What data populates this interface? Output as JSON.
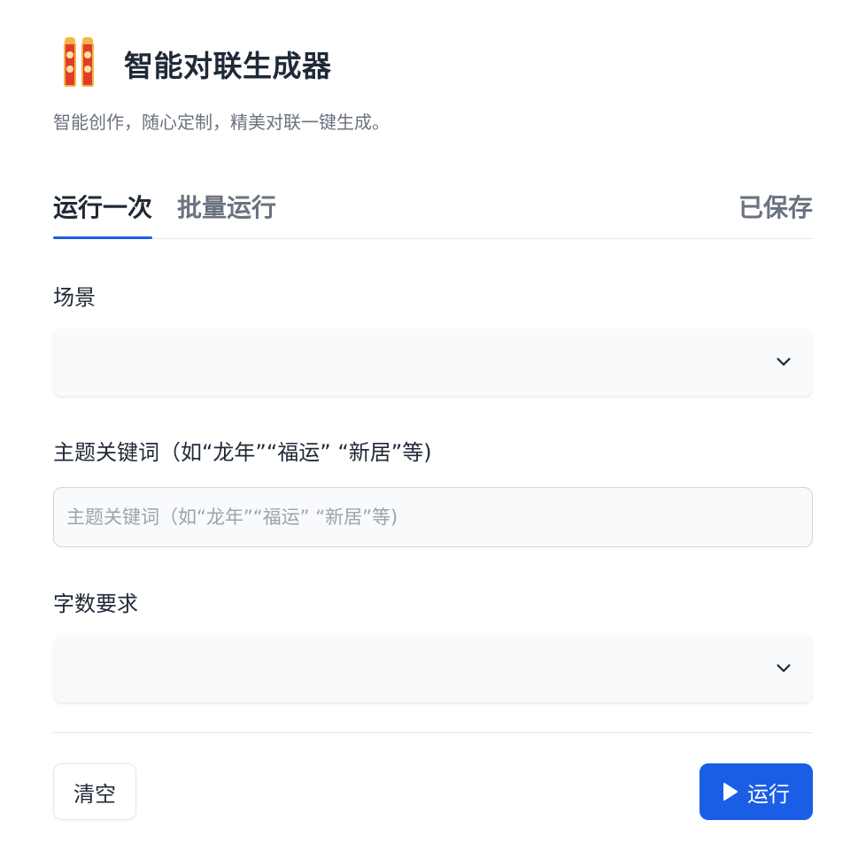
{
  "app": {
    "title": "智能对联生成器",
    "subtitle": "智能创作，随心定制，精美对联一键生成。",
    "icon": "couplet-scrolls-icon"
  },
  "tabs": [
    {
      "label": "运行一次",
      "active": true
    },
    {
      "label": "批量运行",
      "active": false
    }
  ],
  "status": {
    "saved_label": "已保存"
  },
  "form": {
    "scene": {
      "label": "场景",
      "value": ""
    },
    "theme": {
      "label": "主题关键词（如“龙年”“福运” “新居”等)",
      "placeholder": "主题关键词（如“龙年”“福运” “新居”等)",
      "value": ""
    },
    "word_count": {
      "label": "字数要求",
      "value": ""
    }
  },
  "actions": {
    "clear_label": "清空",
    "run_label": "运行"
  },
  "colors": {
    "accent": "#1a5ee6",
    "text": "#1f2937",
    "muted": "#6b7280",
    "field_bg": "#f8fafc",
    "border": "#e5e7eb"
  }
}
